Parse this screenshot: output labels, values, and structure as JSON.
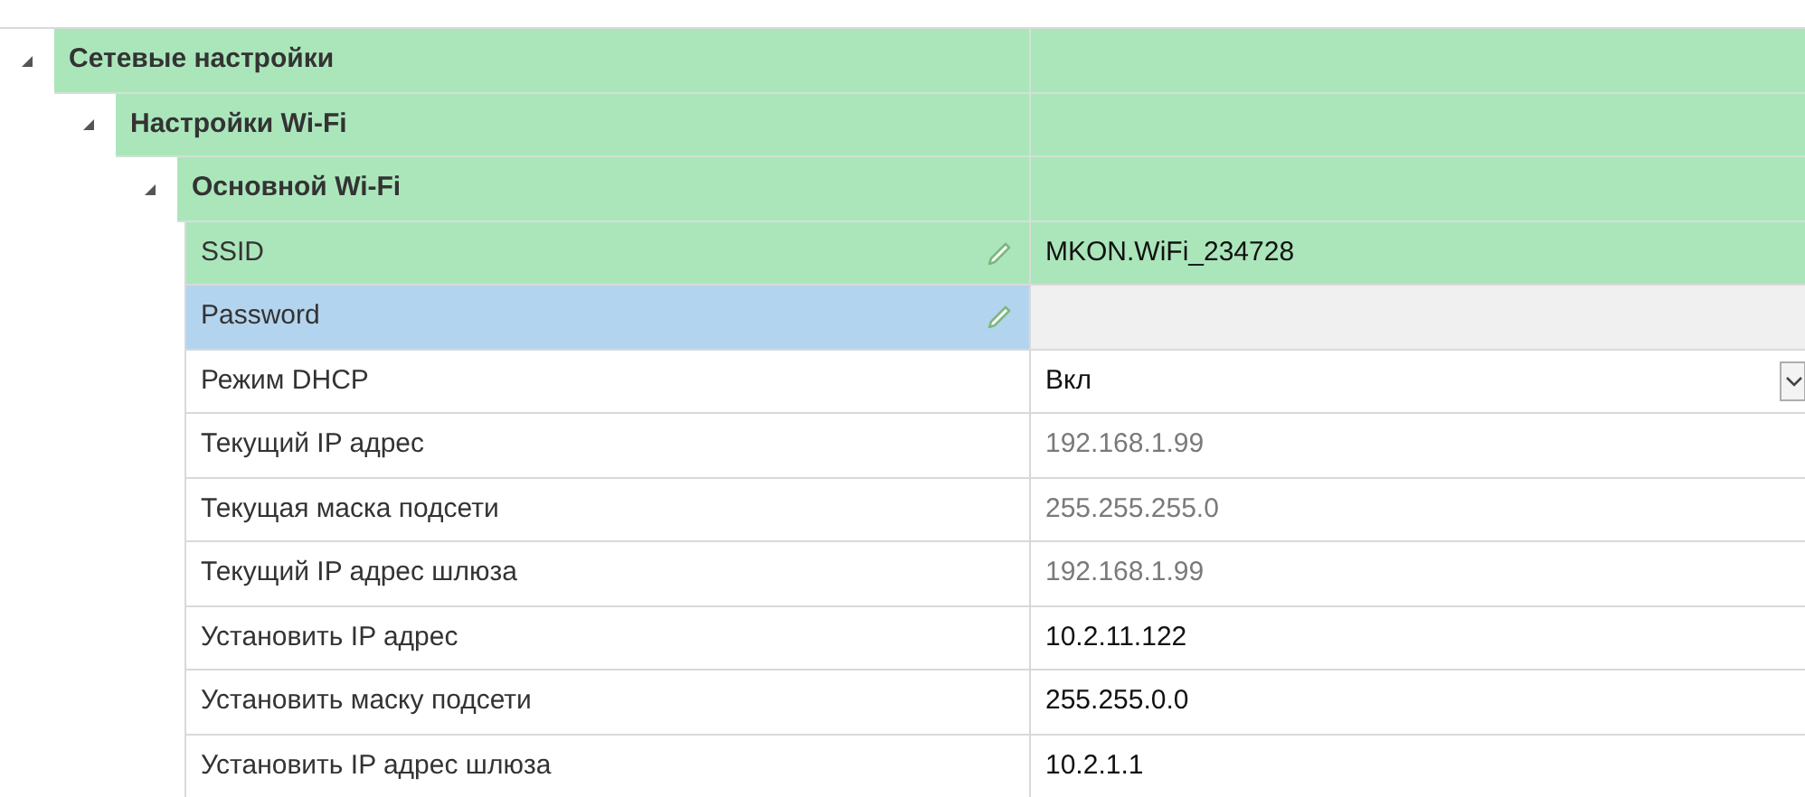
{
  "tree": [
    {
      "kind": "group",
      "label": "Сетевые настройки",
      "expanded": true,
      "children": [
        {
          "kind": "group",
          "label": "Настройки Wi-Fi",
          "expanded": true,
          "children": [
            {
              "kind": "group",
              "label": "Основной Wi-Fi",
              "expanded": true,
              "children": [
                {
                  "kind": "edit",
                  "label": "SSID",
                  "value": "MKON.WiFi_234728",
                  "modified": true,
                  "selected": false,
                  "readonly": false
                },
                {
                  "kind": "edit",
                  "label": "Password",
                  "modified": false,
                  "selected": true,
                  "readonly": false
                },
                {
                  "kind": "select",
                  "label": "Режим DHCP",
                  "value": "Вкл",
                  "modified": false,
                  "selected": false,
                  "readonly": false
                },
                {
                  "kind": "text",
                  "label": "Текущий IP адрес",
                  "value": "192.168.1.99",
                  "modified": false,
                  "selected": false,
                  "readonly": true
                },
                {
                  "kind": "text",
                  "label": "Текущая маска подсети",
                  "value": "255.255.255.0",
                  "modified": false,
                  "selected": false,
                  "readonly": true
                },
                {
                  "kind": "text",
                  "label": "Текущий IP адрес шлюза",
                  "value": "192.168.1.99",
                  "modified": false,
                  "selected": false,
                  "readonly": true
                },
                {
                  "kind": "text",
                  "label": "Установить IP адрес",
                  "value": "10.2.11.122",
                  "modified": false,
                  "selected": false,
                  "readonly": false
                },
                {
                  "kind": "text",
                  "label": "Установить маску подсети",
                  "value": "255.255.0.0",
                  "modified": false,
                  "selected": false,
                  "readonly": false
                },
                {
                  "kind": "text",
                  "label": "Установить IP адрес шлюза",
                  "value": "10.2.1.1",
                  "modified": false,
                  "selected": false,
                  "readonly": false
                }
              ]
            }
          ]
        }
      ]
    }
  ]
}
